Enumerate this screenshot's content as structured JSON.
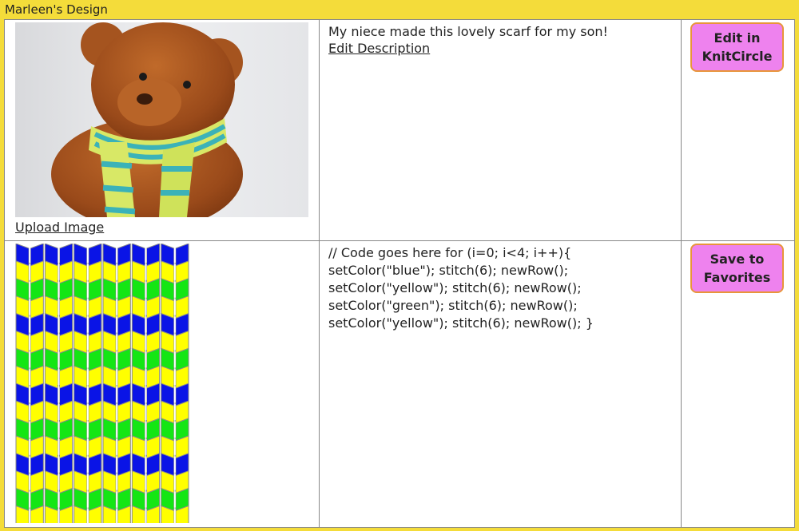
{
  "header": {
    "title": "Marleen's Design"
  },
  "row1": {
    "upload_label": "Upload Image",
    "description": "My niece made this lovely scarf for my son!",
    "edit_description_label": "Edit Description",
    "button_label": "Edit in KnitCircle"
  },
  "row2": {
    "code_lines": [
      "// Code goes here for (i=0; i<4; i++){",
      "setColor(\"blue\"); stitch(6); newRow();",
      "setColor(\"yellow\"); stitch(6); newRow();",
      "setColor(\"green\"); stitch(6); newRow();",
      "setColor(\"yellow\"); stitch(6); newRow(); }"
    ],
    "button_label": "Save to Favorites"
  },
  "pattern": {
    "stitches_per_row": 6,
    "row_colors": [
      "blue",
      "yellow",
      "green",
      "yellow"
    ],
    "colors": {
      "blue": "#0a14e6",
      "yellow": "#ffff00",
      "green": "#14e614"
    }
  },
  "colors": {
    "page_bg": "#f4dc3a",
    "button_bg": "#ee82ee",
    "button_border": "#e8953a"
  }
}
